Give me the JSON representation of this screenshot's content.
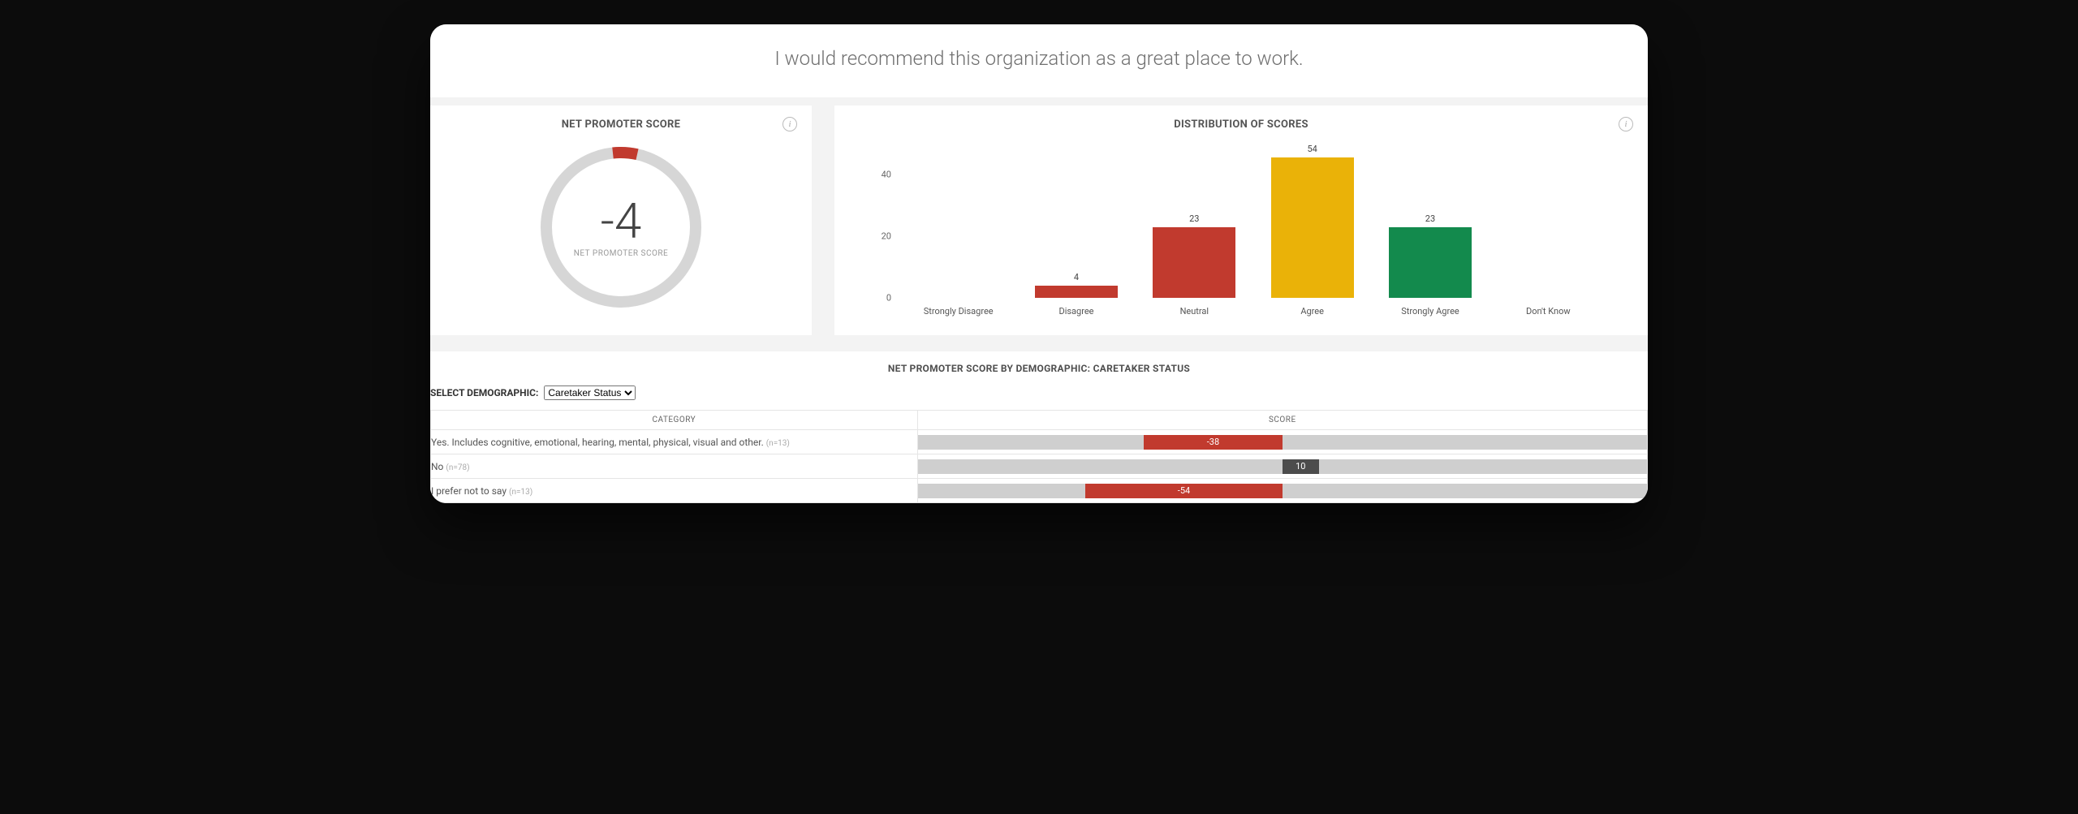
{
  "header": {
    "title": "I would recommend this organization as a great place to work."
  },
  "nps_panel": {
    "title": "NET PROMOTER SCORE",
    "value": "-4",
    "label": "NET PROMOTER SCORE"
  },
  "dist_panel": {
    "title": "DISTRIBUTION OF SCORES"
  },
  "chart_data": {
    "type": "bar",
    "title": "DISTRIBUTION OF SCORES",
    "xlabel": "",
    "ylabel": "",
    "ylim": [
      0,
      50
    ],
    "yticks": [
      0,
      20,
      40
    ],
    "categories": [
      "Strongly Disagree",
      "Disagree",
      "Neutral",
      "Agree",
      "Strongly Agree",
      "Don't Know"
    ],
    "values": [
      0,
      4,
      23,
      54,
      23,
      0
    ],
    "colors": [
      "#c13a2e",
      "#c13a2e",
      "#c13a2e",
      "#eab208",
      "#138a4d",
      "#cfcfcf"
    ]
  },
  "demo": {
    "title": "NET PROMOTER SCORE BY DEMOGRAPHIC: CARETAKER STATUS",
    "select_label": "SELECT DEMOGRAPHIC:",
    "selected": "Caretaker Status",
    "columns": {
      "category": "CATEGORY",
      "score": "SCORE"
    },
    "range": [
      -100,
      100
    ],
    "rows": [
      {
        "label": "Yes. Includes cognitive, emotional, hearing, mental, physical, visual and other.",
        "n": 13,
        "score": -38,
        "color": "#c13a2e"
      },
      {
        "label": "No",
        "n": 78,
        "score": 10,
        "color": "#4c4c4c"
      },
      {
        "label": "I prefer not to say",
        "n": 13,
        "score": -54,
        "color": "#c13a2e"
      }
    ]
  }
}
